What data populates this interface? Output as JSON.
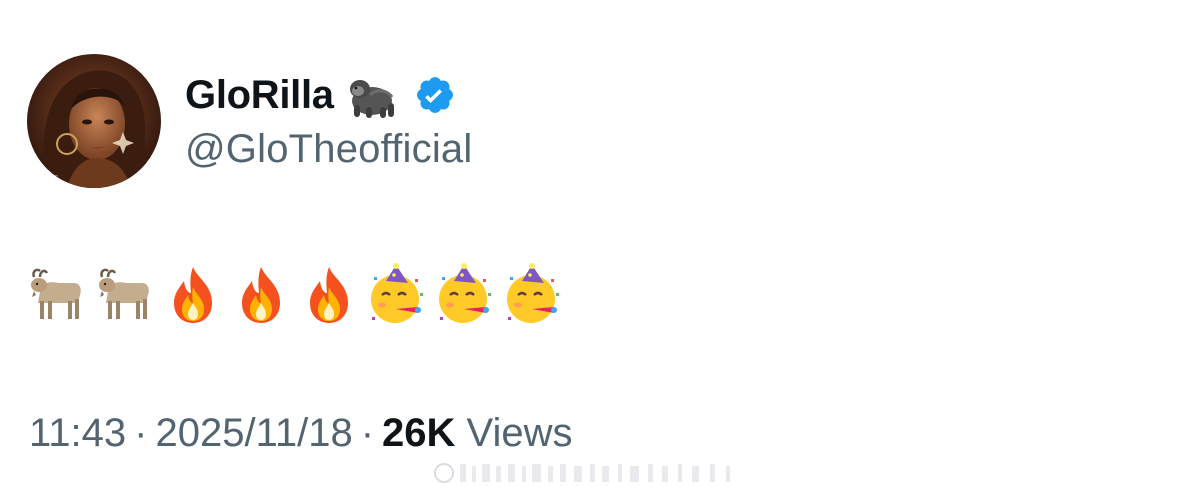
{
  "user": {
    "display_name": "GloRilla",
    "name_emoji_icon": "gorilla-icon",
    "verified_icon": "verified-badge-icon",
    "verified_color": "#1d9bf0",
    "handle": "@GloTheofficial",
    "avatar_icon": "profile-avatar"
  },
  "tweet": {
    "text": "🐐🐐🔥🔥🔥🥳🥳🥳",
    "emojis": [
      "goat-icon",
      "goat-icon",
      "fire-icon",
      "fire-icon",
      "fire-icon",
      "partying-face-icon",
      "partying-face-icon",
      "partying-face-icon"
    ]
  },
  "meta": {
    "time": "11:43",
    "separator": "·",
    "date": "2025/11/18",
    "views_count": "26K",
    "views_label": "Views"
  },
  "colors": {
    "text_primary": "#0f1419",
    "text_secondary": "#536471",
    "background": "#ffffff"
  }
}
